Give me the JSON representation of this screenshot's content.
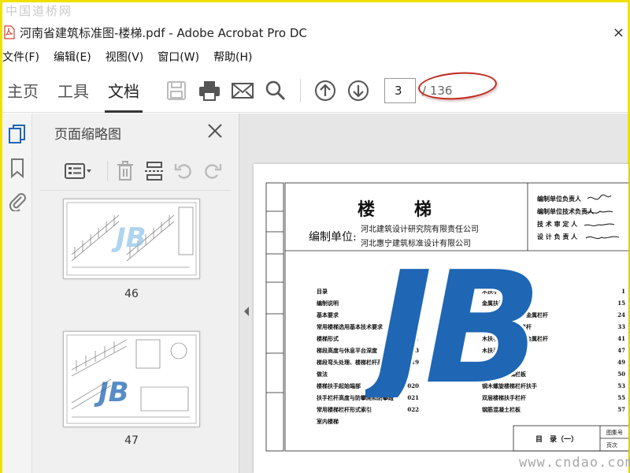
{
  "watermark": {
    "site": "中国道桥网",
    "url": "www.cndao.com"
  },
  "window": {
    "title": "河南省建筑标准图-楼梯.pdf - Adobe Acrobat Pro DC"
  },
  "menu": [
    "文件(F)",
    "编辑(E)",
    "视图(V)",
    "窗口(W)",
    "帮助(H)"
  ],
  "tabs": {
    "home": "主页",
    "tools": "工具",
    "document": "文档"
  },
  "pager": {
    "current": "3",
    "total": "/ 136"
  },
  "thumbnails": {
    "title": "页面缩略图",
    "pages": [
      {
        "label": "46"
      },
      {
        "label": "47"
      }
    ]
  },
  "document": {
    "title": "楼　　梯",
    "compiler_label": "编制单位:",
    "compilers": [
      "河北建筑设计研究院有限责任公司",
      "河北惠宁建筑标准设计有限公司"
    ],
    "roles": [
      "编制单位负责人",
      "编制单位技术负责人",
      "技 术 审 定 人",
      "设 计 负 责 人"
    ],
    "toc_heading": "目　　录",
    "toc_left": [
      {
        "name": "目录",
        "page": "01"
      },
      {
        "name": "编制说明",
        "page": "03"
      },
      {
        "name": "基本要求",
        "page": ""
      },
      {
        "name": "常用楼梯选用基本技术要求",
        "page": "07"
      },
      {
        "name": "楼梯形式",
        "page": "011"
      },
      {
        "name": "梯段高度与休息平台深度",
        "page": "013"
      },
      {
        "name": "梯段弯头处理、楼梯栏杆高度与扶手做法",
        "page": "019"
      },
      {
        "name": "楼梯扶手起始端部",
        "page": "020"
      },
      {
        "name": "扶手栏杆高度与防攀爬和防攀蹬",
        "page": "021"
      },
      {
        "name": "常用楼梯栏杆形式索引",
        "page": "022"
      },
      {
        "name": "室内楼梯",
        "page": ""
      }
    ],
    "toc_right": [
      {
        "name": "木扶手金属栏杆",
        "page": "1"
      },
      {
        "name": "金属扶手金属栏杆",
        "page": "15"
      },
      {
        "name": "木扶手、塑料扶手金属栏杆",
        "page": "24"
      },
      {
        "name": "木扶手金属花饰栏杆",
        "page": "33"
      },
      {
        "name": "木扶手、金属扶手金属栏杆",
        "page": "41"
      },
      {
        "name": "木扶手木栏杆",
        "page": "47"
      },
      {
        "name": "木扶手玻璃栏板",
        "page": "49"
      },
      {
        "name": "金属扶手玻璃栏板",
        "page": "50"
      },
      {
        "name": "钢木螺旋楼梯栏杆扶手",
        "page": "53"
      },
      {
        "name": "双层楼梯扶手栏杆",
        "page": "55"
      },
      {
        "name": "钢筋混凝土栏板",
        "page": "57"
      }
    ],
    "footer_title": "目　录（一）",
    "footer_cells": [
      "图集号",
      "页次"
    ],
    "logo": "JB"
  },
  "colors": {
    "accent": "#1f66b5",
    "highlight": "#c0281d",
    "frame": "#f0e000"
  }
}
